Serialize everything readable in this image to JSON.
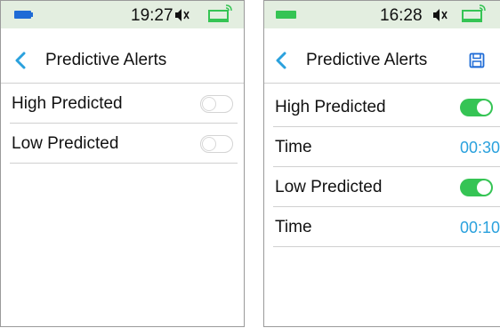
{
  "left_screen": {
    "status": {
      "time": "19:27"
    },
    "header": {
      "title": "Predictive Alerts"
    },
    "rows": [
      {
        "label": "High Predicted",
        "toggle": "off"
      },
      {
        "label": "Low Predicted",
        "toggle": "off"
      }
    ]
  },
  "right_screen": {
    "status": {
      "time": "16:28"
    },
    "header": {
      "title": "Predictive Alerts"
    },
    "rows": [
      {
        "label": "High Predicted",
        "toggle": "on"
      },
      {
        "label": "Time",
        "value": "00:30"
      },
      {
        "label": "Low Predicted",
        "toggle": "on"
      },
      {
        "label": "Time",
        "value": "00:10"
      }
    ]
  },
  "colors": {
    "status_bar_bg": "#e3eee0",
    "accent_blue": "#2aa1dd",
    "battery_blue": "#1f6bd6",
    "toggle_green": "#35c454"
  },
  "icons": [
    "battery-icon",
    "mute-icon",
    "signal-icon",
    "back-icon",
    "save-icon"
  ]
}
